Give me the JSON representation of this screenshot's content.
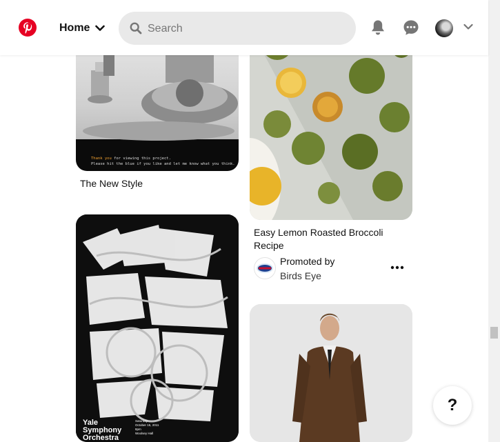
{
  "header": {
    "home_label": "Home",
    "search_placeholder": "Search"
  },
  "pins": [
    {
      "title": "The New Style",
      "image_caption_highlight": "Thank you",
      "image_caption_rest": " for viewing this project.",
      "image_caption_line2": "Please hit the blue if you like and let me know what you think."
    },
    {
      "title_line1": "Easy Lemon Roasted Broccoli",
      "title_line2": "Recipe",
      "promoted_label": "Promoted by",
      "advertiser": "Birds Eye",
      "advertiser_logo_text": "BIRDS EYE"
    },
    {
      "poster_title_lines": [
        "Yale",
        "Symphony",
        "Orchestra"
      ],
      "poster_details": [
        "Saturday",
        "October 15, 2011",
        "8pm",
        "Woolsey Hall"
      ]
    },
    {}
  ],
  "help_button_label": "?",
  "colors": {
    "brand_red": "#e60023",
    "search_bg": "#e9e9e9",
    "icon_gray": "#767676"
  },
  "icons": [
    "pinterest-logo",
    "chevron-down-icon",
    "search-icon",
    "bell-icon",
    "chat-icon",
    "avatar",
    "more-icon",
    "help-icon"
  ]
}
